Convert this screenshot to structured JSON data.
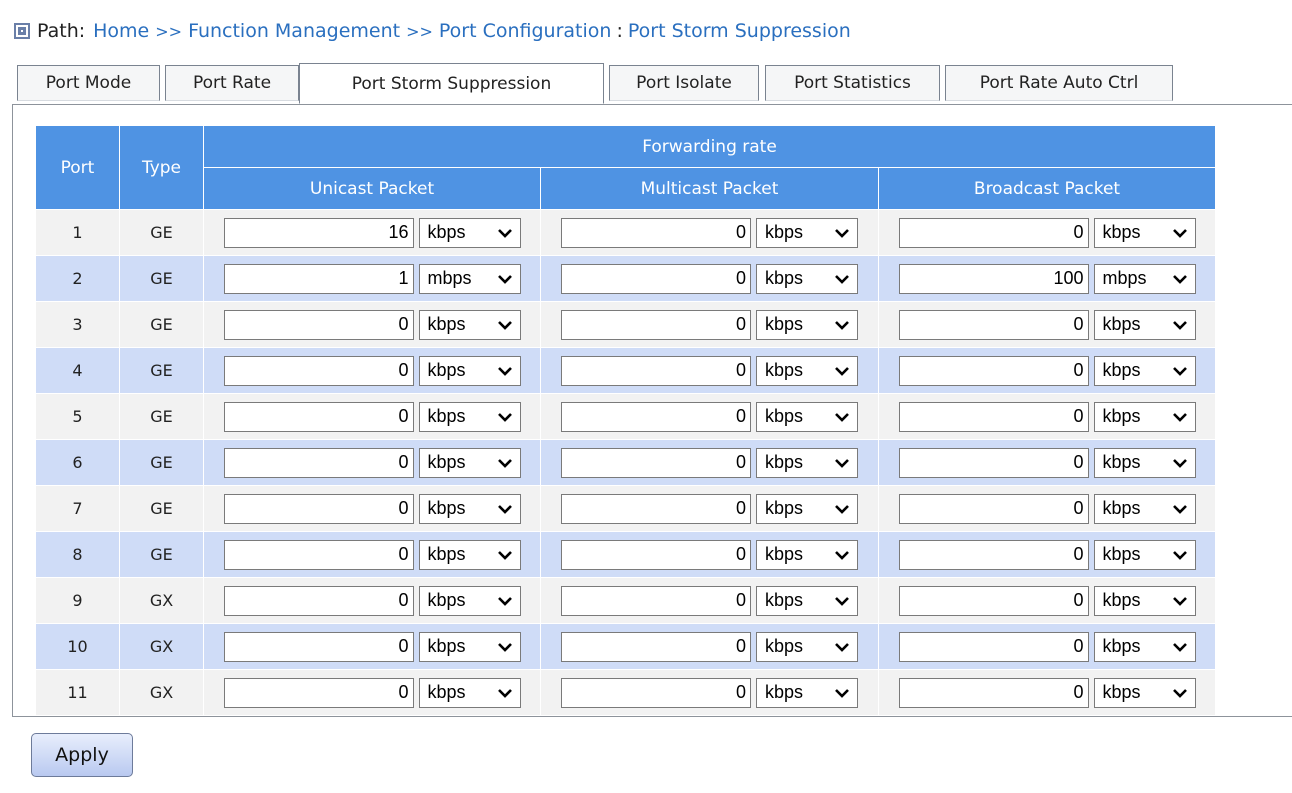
{
  "path": {
    "label": "Path:",
    "crumbs": [
      "Home",
      "Function Management",
      "Port Configuration",
      "Port Storm Suppression"
    ],
    "separator": ">>",
    "last_separator": ":"
  },
  "tabs": [
    {
      "label": "Port Mode",
      "active": false
    },
    {
      "label": "Port Rate",
      "active": false
    },
    {
      "label": "Port Storm Suppression",
      "active": true
    },
    {
      "label": "Port Isolate",
      "active": false
    },
    {
      "label": "Port Statistics",
      "active": false
    },
    {
      "label": "Port Rate Auto Ctrl",
      "active": false
    }
  ],
  "table": {
    "headers": {
      "port": "Port",
      "type": "Type",
      "group": "Forwarding rate",
      "unicast": "Unicast Packet",
      "multicast": "Multicast Packet",
      "broadcast": "Broadcast Packet"
    },
    "rows": [
      {
        "port": "1",
        "type": "GE",
        "unicast": {
          "value": "16",
          "unit": "kbps"
        },
        "multicast": {
          "value": "0",
          "unit": "kbps"
        },
        "broadcast": {
          "value": "0",
          "unit": "kbps"
        }
      },
      {
        "port": "2",
        "type": "GE",
        "unicast": {
          "value": "1",
          "unit": "mbps"
        },
        "multicast": {
          "value": "0",
          "unit": "kbps"
        },
        "broadcast": {
          "value": "100",
          "unit": "mbps"
        }
      },
      {
        "port": "3",
        "type": "GE",
        "unicast": {
          "value": "0",
          "unit": "kbps"
        },
        "multicast": {
          "value": "0",
          "unit": "kbps"
        },
        "broadcast": {
          "value": "0",
          "unit": "kbps"
        }
      },
      {
        "port": "4",
        "type": "GE",
        "unicast": {
          "value": "0",
          "unit": "kbps"
        },
        "multicast": {
          "value": "0",
          "unit": "kbps"
        },
        "broadcast": {
          "value": "0",
          "unit": "kbps"
        }
      },
      {
        "port": "5",
        "type": "GE",
        "unicast": {
          "value": "0",
          "unit": "kbps"
        },
        "multicast": {
          "value": "0",
          "unit": "kbps"
        },
        "broadcast": {
          "value": "0",
          "unit": "kbps"
        }
      },
      {
        "port": "6",
        "type": "GE",
        "unicast": {
          "value": "0",
          "unit": "kbps"
        },
        "multicast": {
          "value": "0",
          "unit": "kbps"
        },
        "broadcast": {
          "value": "0",
          "unit": "kbps"
        }
      },
      {
        "port": "7",
        "type": "GE",
        "unicast": {
          "value": "0",
          "unit": "kbps"
        },
        "multicast": {
          "value": "0",
          "unit": "kbps"
        },
        "broadcast": {
          "value": "0",
          "unit": "kbps"
        }
      },
      {
        "port": "8",
        "type": "GE",
        "unicast": {
          "value": "0",
          "unit": "kbps"
        },
        "multicast": {
          "value": "0",
          "unit": "kbps"
        },
        "broadcast": {
          "value": "0",
          "unit": "kbps"
        }
      },
      {
        "port": "9",
        "type": "GX",
        "unicast": {
          "value": "0",
          "unit": "kbps"
        },
        "multicast": {
          "value": "0",
          "unit": "kbps"
        },
        "broadcast": {
          "value": "0",
          "unit": "kbps"
        }
      },
      {
        "port": "10",
        "type": "GX",
        "unicast": {
          "value": "0",
          "unit": "kbps"
        },
        "multicast": {
          "value": "0",
          "unit": "kbps"
        },
        "broadcast": {
          "value": "0",
          "unit": "kbps"
        }
      },
      {
        "port": "11",
        "type": "GX",
        "unicast": {
          "value": "0",
          "unit": "kbps"
        },
        "multicast": {
          "value": "0",
          "unit": "kbps"
        },
        "broadcast": {
          "value": "0",
          "unit": "kbps"
        }
      }
    ]
  },
  "apply_label": "Apply",
  "icons": {
    "path": "square-bullet-icon",
    "select_arrow": "chevron-down-icon"
  },
  "colors": {
    "header_bg": "#4f93e3",
    "row_alt_bg": "#cfdcf7",
    "link": "#2a6fbf"
  }
}
